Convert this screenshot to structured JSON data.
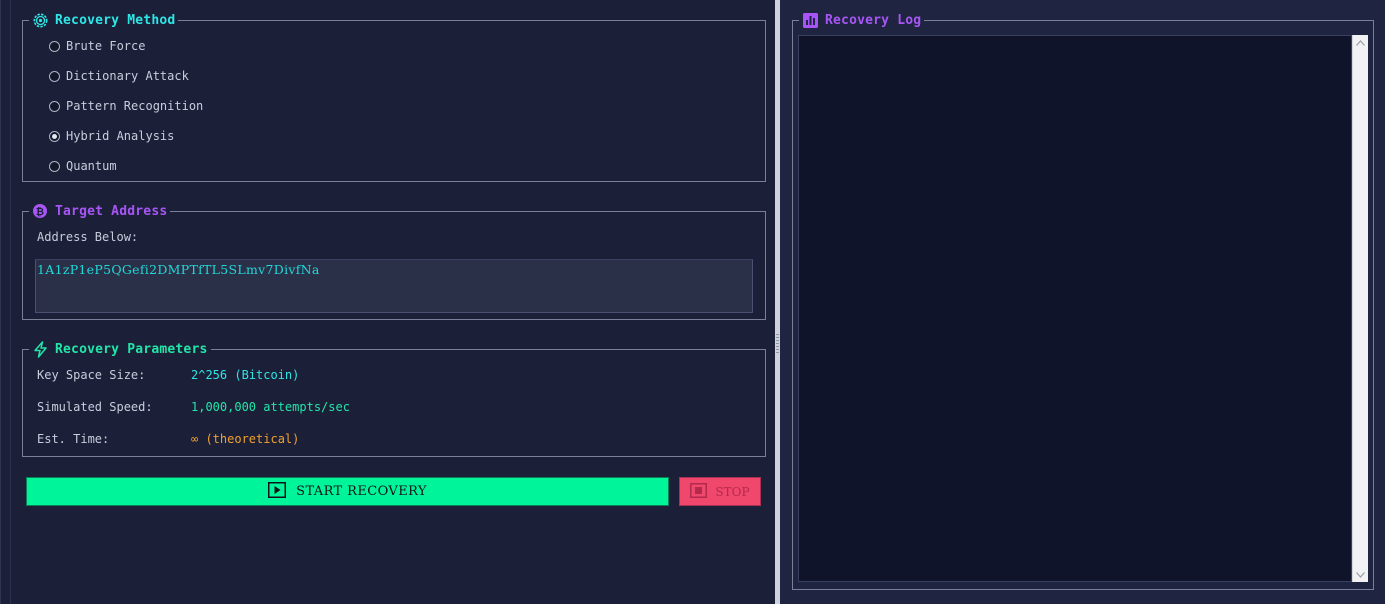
{
  "recovery_method": {
    "title": "Recovery Method",
    "title_color": "#2ee6e6",
    "icon": "gear-icon",
    "selected": "Hybrid Analysis",
    "options": [
      {
        "label": "Brute Force",
        "checked": false
      },
      {
        "label": "Dictionary Attack",
        "checked": false
      },
      {
        "label": "Pattern Recognition",
        "checked": false
      },
      {
        "label": "Hybrid Analysis",
        "checked": true
      },
      {
        "label": "Quantum",
        "checked": false
      }
    ]
  },
  "target_address": {
    "title": "Target Address",
    "title_color": "#a855f7",
    "icon": "bitcoin-icon",
    "label": "Address Below:",
    "value": "1A1zP1eP5QGefi2DMPTfTL5SLmv7DivfNa",
    "value_color": "#22d8d8"
  },
  "recovery_parameters": {
    "title": "Recovery Parameters",
    "title_color": "#22e6a8",
    "icon": "lightning-icon",
    "rows": [
      {
        "label": "Key Space Size:",
        "value": "2^256 (Bitcoin)",
        "color": "#2ee6e6"
      },
      {
        "label": "Simulated Speed:",
        "value": "1,000,000 attempts/sec",
        "color": "#22e6a8"
      },
      {
        "label": "Est. Time:",
        "value": "∞ (theoretical)",
        "color": "#f0a030"
      }
    ]
  },
  "buttons": {
    "start_label": "START RECOVERY",
    "start_icon": "play-icon",
    "start_color": "#00f59a",
    "stop_label": "STOP",
    "stop_icon": "stop-icon",
    "stop_color": "#f0476c"
  },
  "recovery_log": {
    "title": "Recovery Log",
    "title_color": "#a855f7",
    "icon": "chart-icon",
    "content": ""
  }
}
